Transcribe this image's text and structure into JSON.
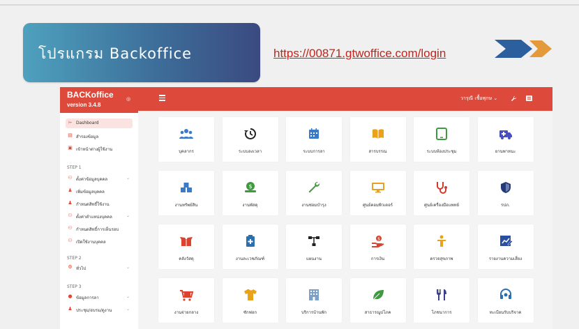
{
  "slide": {
    "title": "โปรแกรม Backoffice",
    "url": "https://00871.gtwoffice.com/login"
  },
  "app": {
    "brand_name": "BACKoffice",
    "version": "version 3.4.8",
    "user_name": "วารุณี เชื้อพุกษ",
    "colors": {
      "accent": "#dd4a3b",
      "title_gradient_start": "#4ea1be",
      "title_gradient_end": "#3b4a80",
      "arrow_dark": "#2c5f9e",
      "arrow_light": "#e49a3a"
    }
  },
  "sidebar": {
    "items": [
      {
        "label": "Dashboard",
        "icon": "send-icon",
        "active": true
      },
      {
        "label": "สำรองข้อมูล",
        "icon": "database-icon"
      },
      {
        "label": "เข้าหน้าต่างผู้ใช้งาน",
        "icon": "window-icon"
      }
    ],
    "step1": "STEP 1",
    "step1_items": [
      {
        "label": "ตั้งค่าข้อมูลบุคคล",
        "icon": "users-icon",
        "chevron": true
      },
      {
        "label": "เพิ่มข้อมูลบุคคล",
        "icon": "user-icon"
      },
      {
        "label": "กำหนดสิทธิ์ใช้งาน",
        "icon": "user-icon"
      },
      {
        "label": "ตั้งค่าตำแหน่งบุคคล",
        "icon": "users-icon",
        "chevron": true
      },
      {
        "label": "กำหนดสิทธิ์การเห็นรอบ",
        "icon": "users-icon"
      },
      {
        "label": "เปิดใช้งานบุคคล",
        "icon": "users-icon"
      }
    ],
    "step2": "STEP 2",
    "step2_items": [
      {
        "label": "ทั่วไป",
        "icon": "gears-icon",
        "chevron": true
      }
    ],
    "step3": "STEP 3",
    "step3_items": [
      {
        "label": "ข้อมูลการลา",
        "icon": "info-icon",
        "chevron": true
      },
      {
        "label": "ประชุม/อบรม/ดูงาน",
        "icon": "group-icon",
        "chevron": true
      }
    ]
  },
  "modules": [
    {
      "label": "บุคลากร",
      "icon": "people-icon",
      "color": "#3b7ac9"
    },
    {
      "label": "ระบบลงเวลา",
      "icon": "history-icon",
      "color": "#222222"
    },
    {
      "label": "ระบบการลา",
      "icon": "calendar-icon",
      "color": "#3b7ac9"
    },
    {
      "label": "สารบรรณ",
      "icon": "book-icon",
      "color": "#e8a21b"
    },
    {
      "label": "ระบบห้องประชุม",
      "icon": "tablet-icon",
      "color": "#3f9a3f"
    },
    {
      "label": "ยานพาหนะ",
      "icon": "ambulance-icon",
      "color": "#4a4fbf"
    },
    {
      "label": "งานทรัพย์สิน",
      "icon": "boxes-icon",
      "color": "#3b7ac9"
    },
    {
      "label": "งานพัสดุ",
      "icon": "money-icon",
      "color": "#3f9a3f"
    },
    {
      "label": "งานซ่อมบำรุง",
      "icon": "wrench-icon",
      "color": "#3f9a3f"
    },
    {
      "label": "ศูนย์คอมพิวเตอร์",
      "icon": "desktop-icon",
      "color": "#e8a21b"
    },
    {
      "label": "ศูนย์เครื่องมือแพทย์",
      "icon": "stethoscope-icon",
      "color": "#d23a2c"
    },
    {
      "label": "รปภ.",
      "icon": "shield-icon",
      "color": "#223a7a"
    },
    {
      "label": "คลังวัสดุ",
      "icon": "box-open-icon",
      "color": "#d9432f"
    },
    {
      "label": "งานละเวชภัณฑ์",
      "icon": "medkit-icon",
      "color": "#2a6fb0"
    },
    {
      "label": "แผนงาน",
      "icon": "sitemap-icon",
      "color": "#222222"
    },
    {
      "label": "การเงิน",
      "icon": "hand-money-icon",
      "color": "#d9432f"
    },
    {
      "label": "ตรวจสุขภาพ",
      "icon": "person-icon",
      "color": "#e8a21b"
    },
    {
      "label": "รายงานความเสี่ยง",
      "icon": "chart-report-icon",
      "color": "#2a4fa0"
    },
    {
      "label": "งานจ่ายกลาง",
      "icon": "cart-icon",
      "color": "#d9432f"
    },
    {
      "label": "ซักฟอก",
      "icon": "tshirt-icon",
      "color": "#e8a21b"
    },
    {
      "label": "บริการบ้านพัก",
      "icon": "building-icon",
      "color": "#7da0c8"
    },
    {
      "label": "สาธารณูปโภค",
      "icon": "leaf-icon",
      "color": "#3f9a3f"
    },
    {
      "label": "โภชนาการ",
      "icon": "utensils-icon",
      "color": "#3b3f8c"
    },
    {
      "label": "ทะเบียนรับบริจาค",
      "icon": "headset-icon",
      "color": "#2a6fb0"
    }
  ]
}
